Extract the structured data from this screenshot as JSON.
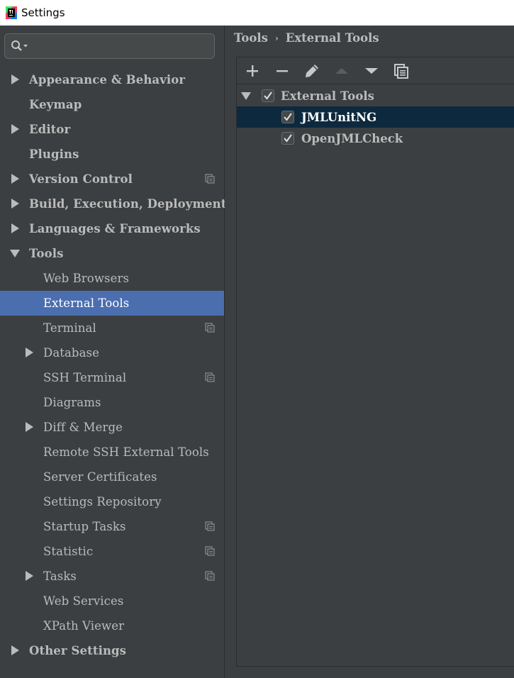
{
  "window": {
    "title": "Settings"
  },
  "search": {
    "placeholder": ""
  },
  "sidebar": {
    "items": [
      {
        "label": "Appearance & Behavior",
        "level": 0,
        "expandable": true,
        "expanded": false,
        "selected": false,
        "project_icon": false
      },
      {
        "label": "Keymap",
        "level": 0,
        "expandable": false,
        "expanded": false,
        "selected": false,
        "project_icon": false
      },
      {
        "label": "Editor",
        "level": 0,
        "expandable": true,
        "expanded": false,
        "selected": false,
        "project_icon": false
      },
      {
        "label": "Plugins",
        "level": 0,
        "expandable": false,
        "expanded": false,
        "selected": false,
        "project_icon": false
      },
      {
        "label": "Version Control",
        "level": 0,
        "expandable": true,
        "expanded": false,
        "selected": false,
        "project_icon": true
      },
      {
        "label": "Build, Execution, Deployment",
        "level": 0,
        "expandable": true,
        "expanded": false,
        "selected": false,
        "project_icon": false
      },
      {
        "label": "Languages & Frameworks",
        "level": 0,
        "expandable": true,
        "expanded": false,
        "selected": false,
        "project_icon": false
      },
      {
        "label": "Tools",
        "level": 0,
        "expandable": true,
        "expanded": true,
        "selected": false,
        "project_icon": false
      },
      {
        "label": "Web Browsers",
        "level": 1,
        "expandable": false,
        "expanded": false,
        "selected": false,
        "project_icon": false
      },
      {
        "label": "External Tools",
        "level": 1,
        "expandable": false,
        "expanded": false,
        "selected": true,
        "project_icon": false
      },
      {
        "label": "Terminal",
        "level": 1,
        "expandable": false,
        "expanded": false,
        "selected": false,
        "project_icon": true
      },
      {
        "label": "Database",
        "level": 1,
        "expandable": true,
        "expanded": false,
        "selected": false,
        "project_icon": false
      },
      {
        "label": "SSH Terminal",
        "level": 1,
        "expandable": false,
        "expanded": false,
        "selected": false,
        "project_icon": true
      },
      {
        "label": "Diagrams",
        "level": 1,
        "expandable": false,
        "expanded": false,
        "selected": false,
        "project_icon": false
      },
      {
        "label": "Diff & Merge",
        "level": 1,
        "expandable": true,
        "expanded": false,
        "selected": false,
        "project_icon": false
      },
      {
        "label": "Remote SSH External Tools",
        "level": 1,
        "expandable": false,
        "expanded": false,
        "selected": false,
        "project_icon": false
      },
      {
        "label": "Server Certificates",
        "level": 1,
        "expandable": false,
        "expanded": false,
        "selected": false,
        "project_icon": false
      },
      {
        "label": "Settings Repository",
        "level": 1,
        "expandable": false,
        "expanded": false,
        "selected": false,
        "project_icon": false
      },
      {
        "label": "Startup Tasks",
        "level": 1,
        "expandable": false,
        "expanded": false,
        "selected": false,
        "project_icon": true
      },
      {
        "label": "Statistic",
        "level": 1,
        "expandable": false,
        "expanded": false,
        "selected": false,
        "project_icon": true
      },
      {
        "label": "Tasks",
        "level": 1,
        "expandable": true,
        "expanded": false,
        "selected": false,
        "project_icon": true
      },
      {
        "label": "Web Services",
        "level": 1,
        "expandable": false,
        "expanded": false,
        "selected": false,
        "project_icon": false
      },
      {
        "label": "XPath Viewer",
        "level": 1,
        "expandable": false,
        "expanded": false,
        "selected": false,
        "project_icon": false
      },
      {
        "label": "Other Settings",
        "level": 0,
        "expandable": true,
        "expanded": false,
        "selected": false,
        "project_icon": false
      }
    ]
  },
  "breadcrumb": {
    "parent": "Tools",
    "current": "External Tools"
  },
  "toolbar": {
    "buttons": [
      {
        "name": "add-icon",
        "enabled": true
      },
      {
        "name": "remove-icon",
        "enabled": true
      },
      {
        "name": "edit-icon",
        "enabled": true
      },
      {
        "name": "move-up-icon",
        "enabled": false
      },
      {
        "name": "move-down-icon",
        "enabled": true
      },
      {
        "name": "copy-icon",
        "enabled": true
      }
    ]
  },
  "external_tools": {
    "group": {
      "label": "External Tools",
      "checked": true,
      "expanded": true
    },
    "items": [
      {
        "label": "JMLUnitNG",
        "checked": true,
        "selected": true
      },
      {
        "label": "OpenJMLCheck",
        "checked": true,
        "selected": false
      }
    ]
  },
  "colors": {
    "background": "#3c3f41",
    "selection_sidebar": "#4b6eaf",
    "selection_list": "#0d293e",
    "text": "#bbbbbb"
  }
}
